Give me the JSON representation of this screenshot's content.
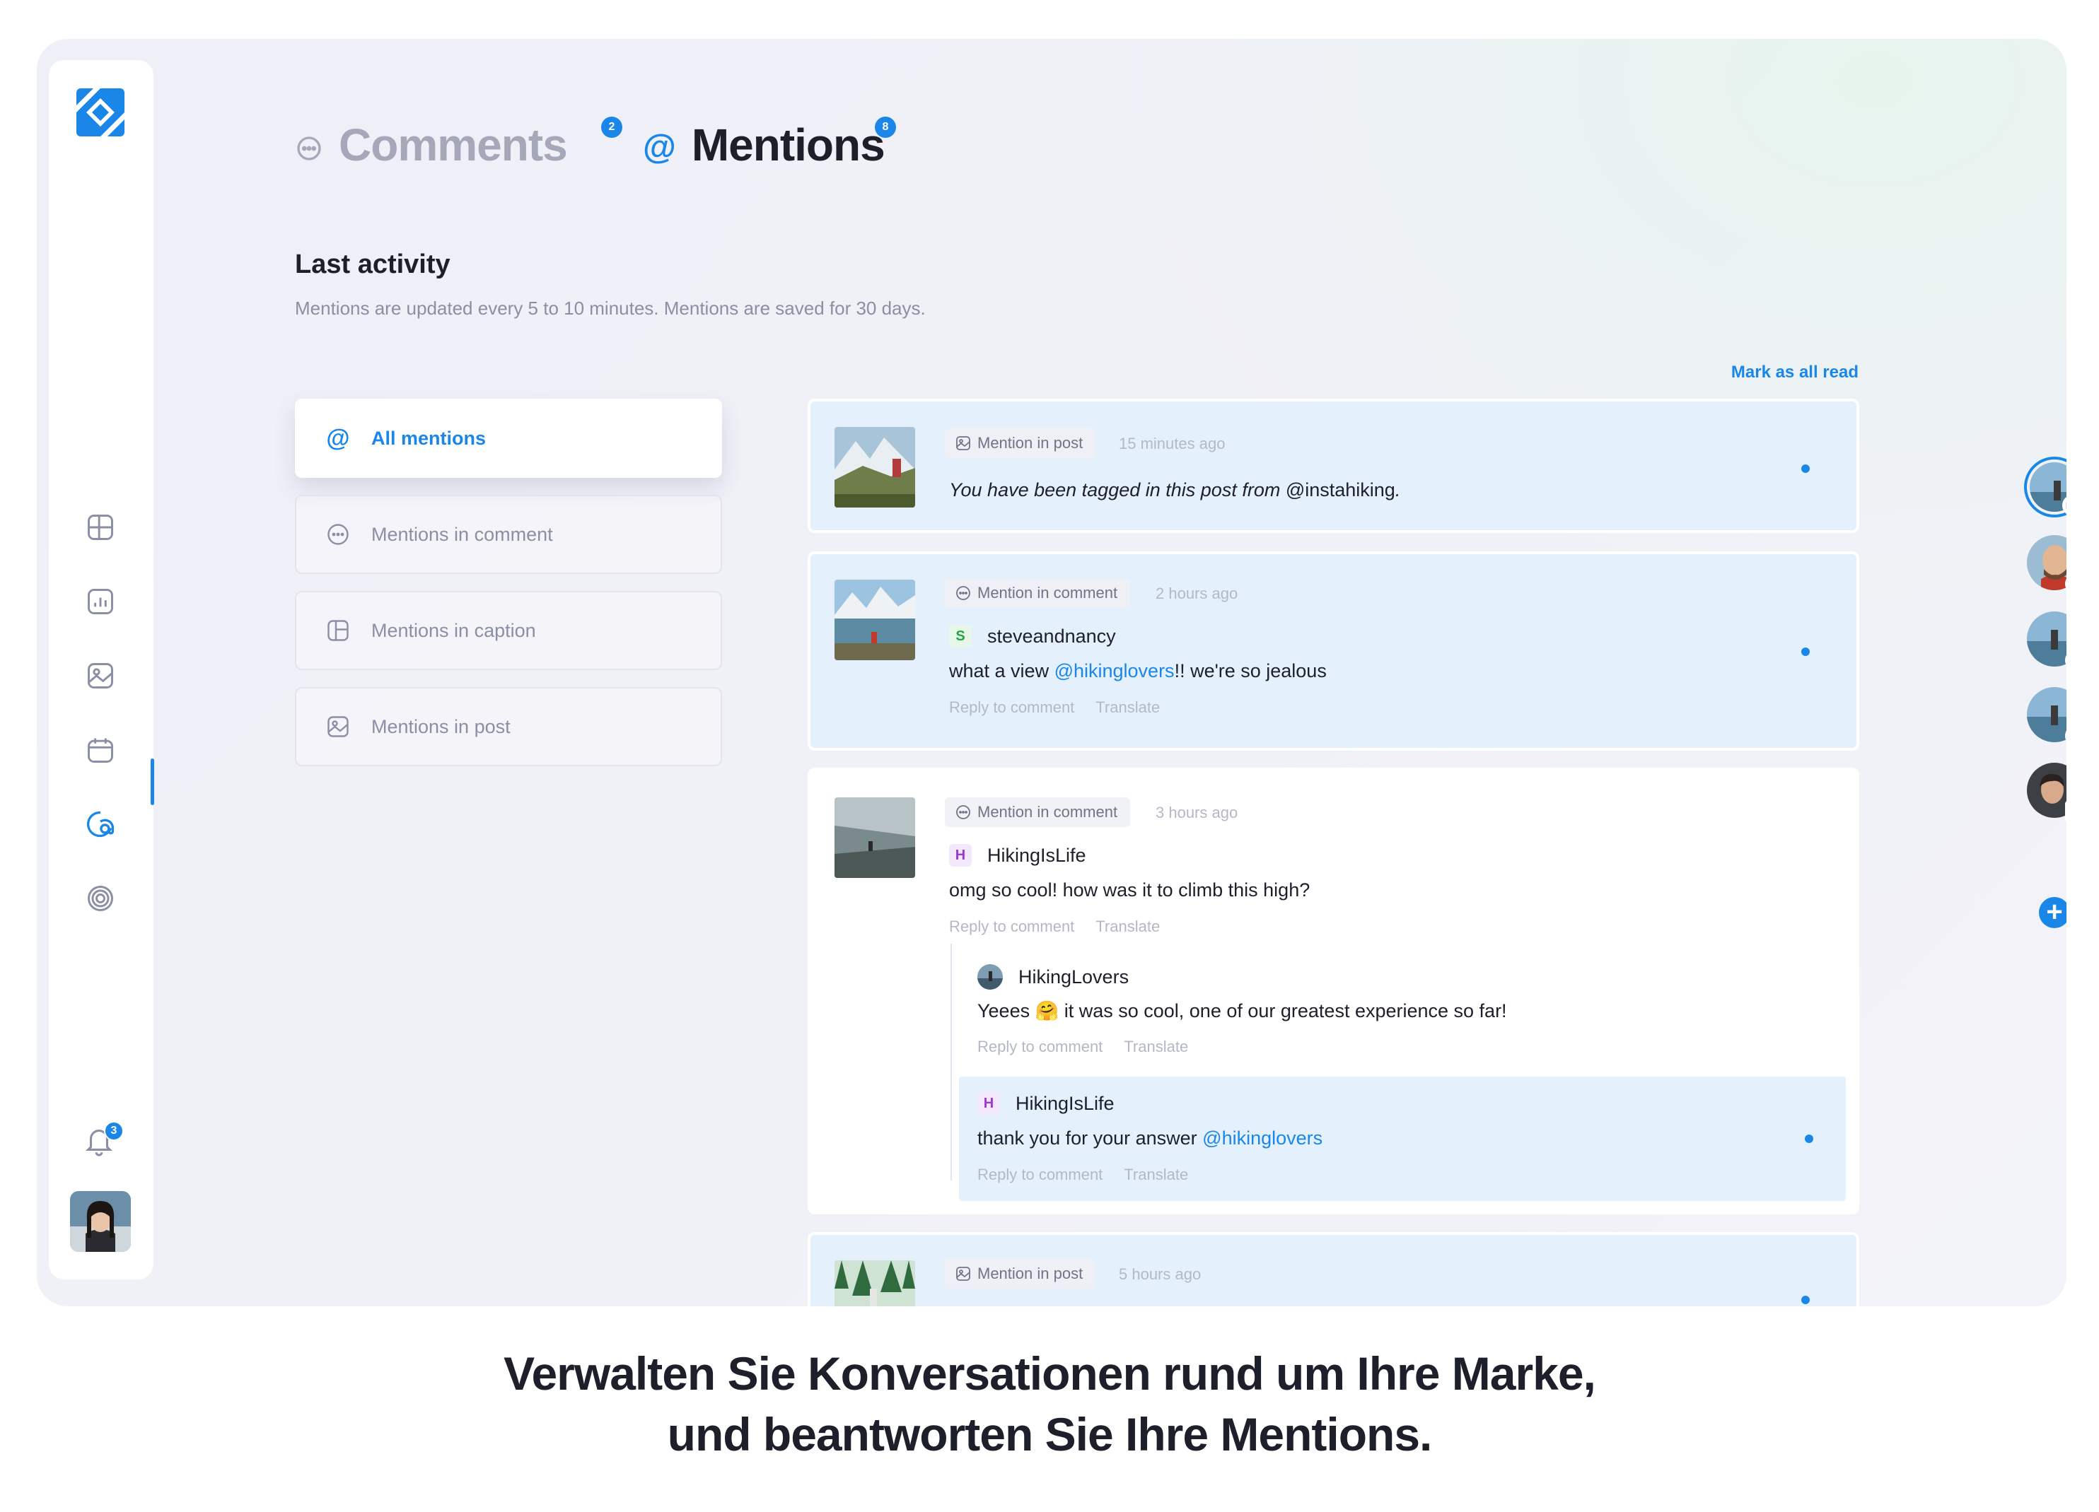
{
  "tabs": [
    {
      "label": "Comments",
      "badge": "2",
      "active": false
    },
    {
      "label": "Mentions",
      "badge": "8",
      "active": true
    }
  ],
  "section": {
    "title": "Last activity",
    "subtitle": "Mentions are updated every 5 to 10 minutes. Mentions are saved for 30 days.",
    "mark_all_read": "Mark as all read"
  },
  "filters": [
    {
      "label": "All mentions",
      "icon": "at-icon",
      "active": true
    },
    {
      "label": "Mentions in comment",
      "icon": "comment-icon",
      "active": false
    },
    {
      "label": "Mentions in caption",
      "icon": "caption-icon",
      "active": false
    },
    {
      "label": "Mentions in post",
      "icon": "image-icon",
      "active": false
    }
  ],
  "notifications_badge": "3",
  "cards": [
    {
      "tag": "Mention in post",
      "time": "15 minutes ago",
      "text_before": "You have been tagged in this post from ",
      "text_handle": "@instahiking",
      "text_after": "."
    },
    {
      "tag": "Mention in comment",
      "time": "2 hours ago",
      "user_initial": "S",
      "user": "steveandnancy",
      "text_before": "what a view ",
      "text_handle": "@hikinglovers",
      "text_after": "!! we're so jealous",
      "reply": "Reply to comment",
      "translate": "Translate"
    },
    {
      "tag": "Mention in comment",
      "time": "3 hours ago",
      "user_initial": "H",
      "user": "HikingIsLife",
      "text": "omg so cool! how was it to climb this high?",
      "reply": "Reply to comment",
      "translate": "Translate",
      "replies": [
        {
          "user": "HikingLovers",
          "text_before": "Yeees ",
          "emoji": "🤗",
          "text_after": " it was so cool, one of our greatest experience so far!",
          "reply": "Reply to comment",
          "translate": "Translate"
        },
        {
          "user_initial": "H",
          "user": "HikingIsLife",
          "text_before": "thank you for your answer ",
          "text_handle": "@hikinglovers",
          "reply": "Reply to comment",
          "translate": "Translate"
        }
      ]
    },
    {
      "tag": "Mention in post",
      "time": "5 hours ago"
    }
  ],
  "social_accounts": [
    {
      "network": "instagram",
      "icon": "instagram-icon",
      "color": "#e1306c",
      "active": true
    },
    {
      "network": "instagram",
      "icon": "instagram-icon",
      "color": "#e1306c",
      "active": false
    },
    {
      "network": "facebook",
      "icon": "facebook-icon",
      "color": "#1877f2",
      "active": false
    },
    {
      "network": "twitter",
      "icon": "twitter-icon",
      "color": "#1d9bf0",
      "active": false
    },
    {
      "network": "linkedin",
      "icon": "linkedin-icon",
      "color": "#0a66c2",
      "active": false
    }
  ],
  "caption": [
    "Verwalten Sie Konversationen rund um Ihre Marke,",
    "und beantworten Sie Ihre Mentions."
  ],
  "colors": {
    "accent": "#1a87e8",
    "card_unread": "#e4f1fc",
    "muted": "#8a8fa3"
  }
}
